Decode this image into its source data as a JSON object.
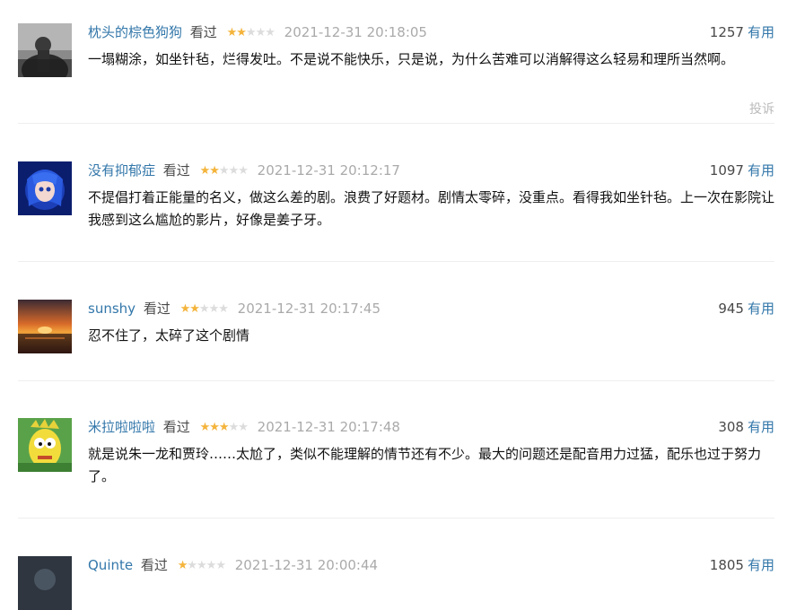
{
  "comments": [
    {
      "user": "枕头的棕色狗狗",
      "status": "看过",
      "rating": 2,
      "time": "2021-12-31 20:18:05",
      "votes": "1257",
      "useful_label": "有用",
      "text": "一塌糊涂，如坐针毡，烂得发吐。不是说不能快乐，只是说，为什么苦难可以消解得这么轻易和理所当然啊。",
      "report_label": "投诉"
    },
    {
      "user": "没有抑郁症",
      "status": "看过",
      "rating": 2,
      "time": "2021-12-31 20:12:17",
      "votes": "1097",
      "useful_label": "有用",
      "text": "不提倡打着正能量的名义，做这么差的剧。浪费了好题材。剧情太零碎，没重点。看得我如坐针毡。上一次在影院让我感到这么尴尬的影片，好像是姜子牙。"
    },
    {
      "user": "sunshy",
      "status": "看过",
      "rating": 2,
      "time": "2021-12-31 20:17:45",
      "votes": "945",
      "useful_label": "有用",
      "text": "忍不住了，太碎了这个剧情"
    },
    {
      "user": "米拉啦啦啦",
      "status": "看过",
      "rating": 3,
      "time": "2021-12-31 20:17:48",
      "votes": "308",
      "useful_label": "有用",
      "text": "就是说朱一龙和贾玲……太尬了，类似不能理解的情节还有不少。最大的问题还是配音用力过猛，配乐也过于努力了。"
    },
    {
      "user": "Quinte",
      "status": "看过",
      "rating": 1,
      "time": "2021-12-31 20:00:44",
      "votes": "1805",
      "useful_label": "有用",
      "text": ""
    }
  ],
  "colors": {
    "link": "#3377aa",
    "star": "#f4b43c",
    "star_empty": "#dcdcdc",
    "time": "#aaaaaa"
  }
}
